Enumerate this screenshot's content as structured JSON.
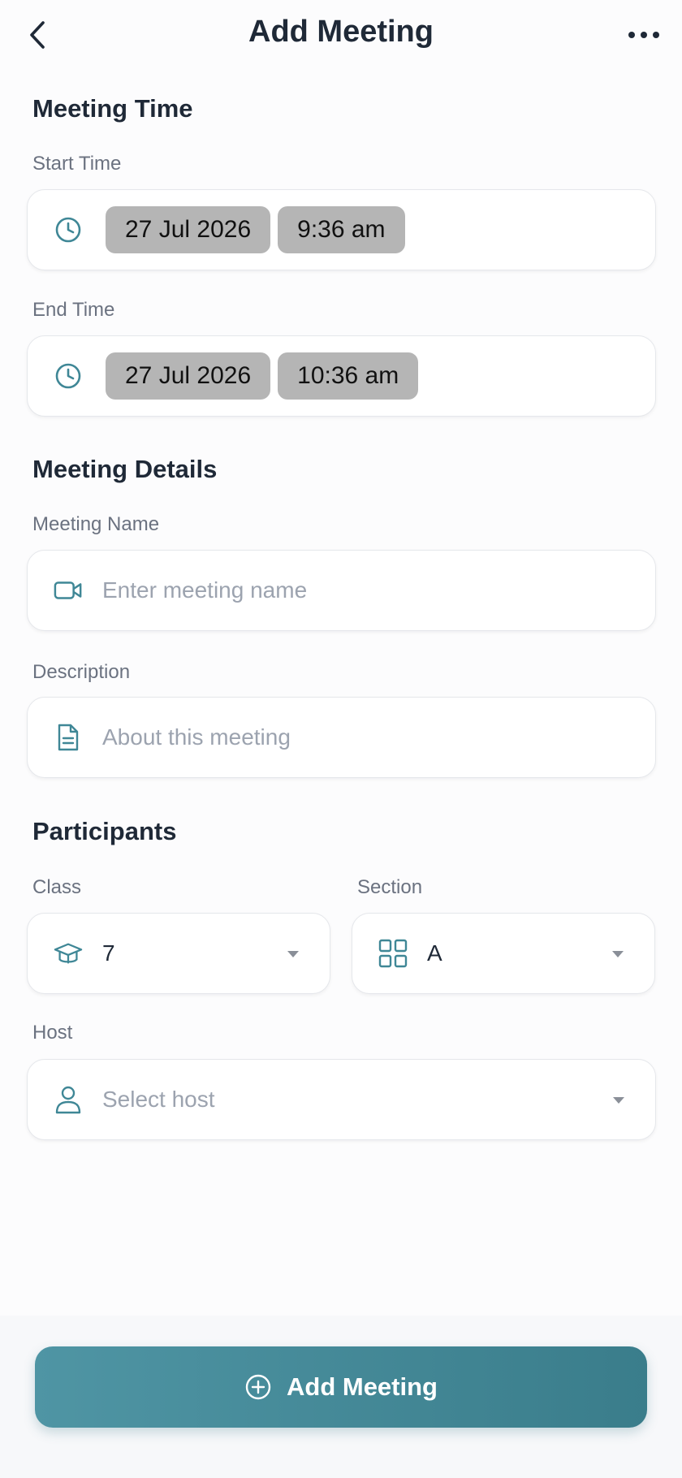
{
  "header": {
    "title": "Add Meeting",
    "back_icon": "chevron-left-icon",
    "more_icon": "more-horizontal-icon"
  },
  "meeting_time": {
    "title": "Meeting Time",
    "start": {
      "label": "Start Time",
      "date": "27 Jul 2026",
      "time": "9:36 am",
      "icon": "clock-icon"
    },
    "end": {
      "label": "End Time",
      "date": "27 Jul 2026",
      "time": "10:36 am",
      "icon": "clock-icon"
    }
  },
  "meeting_details": {
    "title": "Meeting Details",
    "name": {
      "label": "Meeting Name",
      "placeholder": "Enter meeting name",
      "value": "",
      "icon": "video-icon"
    },
    "description": {
      "label": "Description",
      "placeholder": "About this meeting",
      "value": "",
      "icon": "document-icon"
    }
  },
  "participants": {
    "title": "Participants",
    "class": {
      "label": "Class",
      "value": "7",
      "icon": "graduation-cap-icon"
    },
    "section": {
      "label": "Section",
      "value": "A",
      "icon": "grid-icon"
    },
    "host": {
      "label": "Host",
      "placeholder": "Select host",
      "value": "",
      "icon": "user-icon"
    }
  },
  "actions": {
    "add_label": "Add Meeting",
    "add_icon": "plus-circle-icon"
  },
  "colors": {
    "accent": "#3f8796",
    "chip": "#b5b5b5",
    "label": "#6b7280",
    "placeholder": "#9ca3af"
  }
}
